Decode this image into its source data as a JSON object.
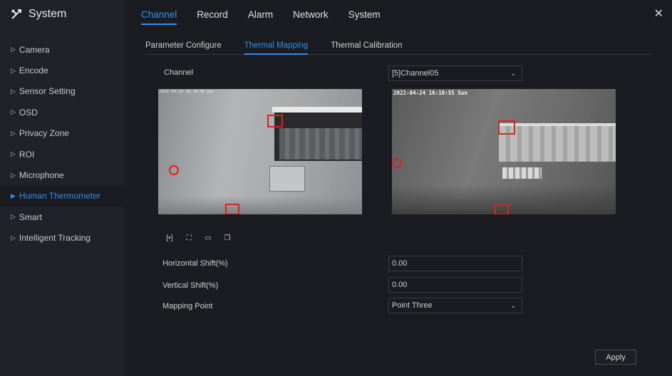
{
  "app": {
    "title": "System"
  },
  "sidebar": {
    "items": [
      {
        "label": "Camera"
      },
      {
        "label": "Encode"
      },
      {
        "label": "Sensor Setting"
      },
      {
        "label": "OSD"
      },
      {
        "label": "Privacy Zone"
      },
      {
        "label": "ROI"
      },
      {
        "label": "Microphone"
      },
      {
        "label": "Human Thermometer",
        "active": true
      },
      {
        "label": "Smart"
      },
      {
        "label": "Intelligent Tracking"
      }
    ]
  },
  "topnav": {
    "tabs": [
      {
        "label": "Channel",
        "active": true
      },
      {
        "label": "Record"
      },
      {
        "label": "Alarm"
      },
      {
        "label": "Network"
      },
      {
        "label": "System"
      }
    ]
  },
  "subtabs": [
    {
      "label": "Parameter Configure"
    },
    {
      "label": "Thermal Mapping",
      "active": true
    },
    {
      "label": "Thermal Calibration"
    }
  ],
  "form": {
    "channel_label": "Channel",
    "channel_value": "[5]Channel05",
    "h_shift_label": "Horizontal Shift(%)",
    "h_shift_value": "0.00",
    "v_shift_label": "Vertical Shift(%)",
    "v_shift_value": "0.00",
    "mapping_label": "Mapping Point",
    "mapping_value": "Point Three"
  },
  "video": {
    "left_timestamp": "2022-04-24 16:10:56 Sun",
    "right_timestamp": "2022-04-24 16:10:55 Sun"
  },
  "toolbar": {
    "icons": [
      "fit-icon",
      "fullscreen-icon",
      "window-icon",
      "copy-icon"
    ]
  },
  "apply_label": "Apply",
  "colors": {
    "accent": "#2f8ff0",
    "marker": "#e02020"
  }
}
